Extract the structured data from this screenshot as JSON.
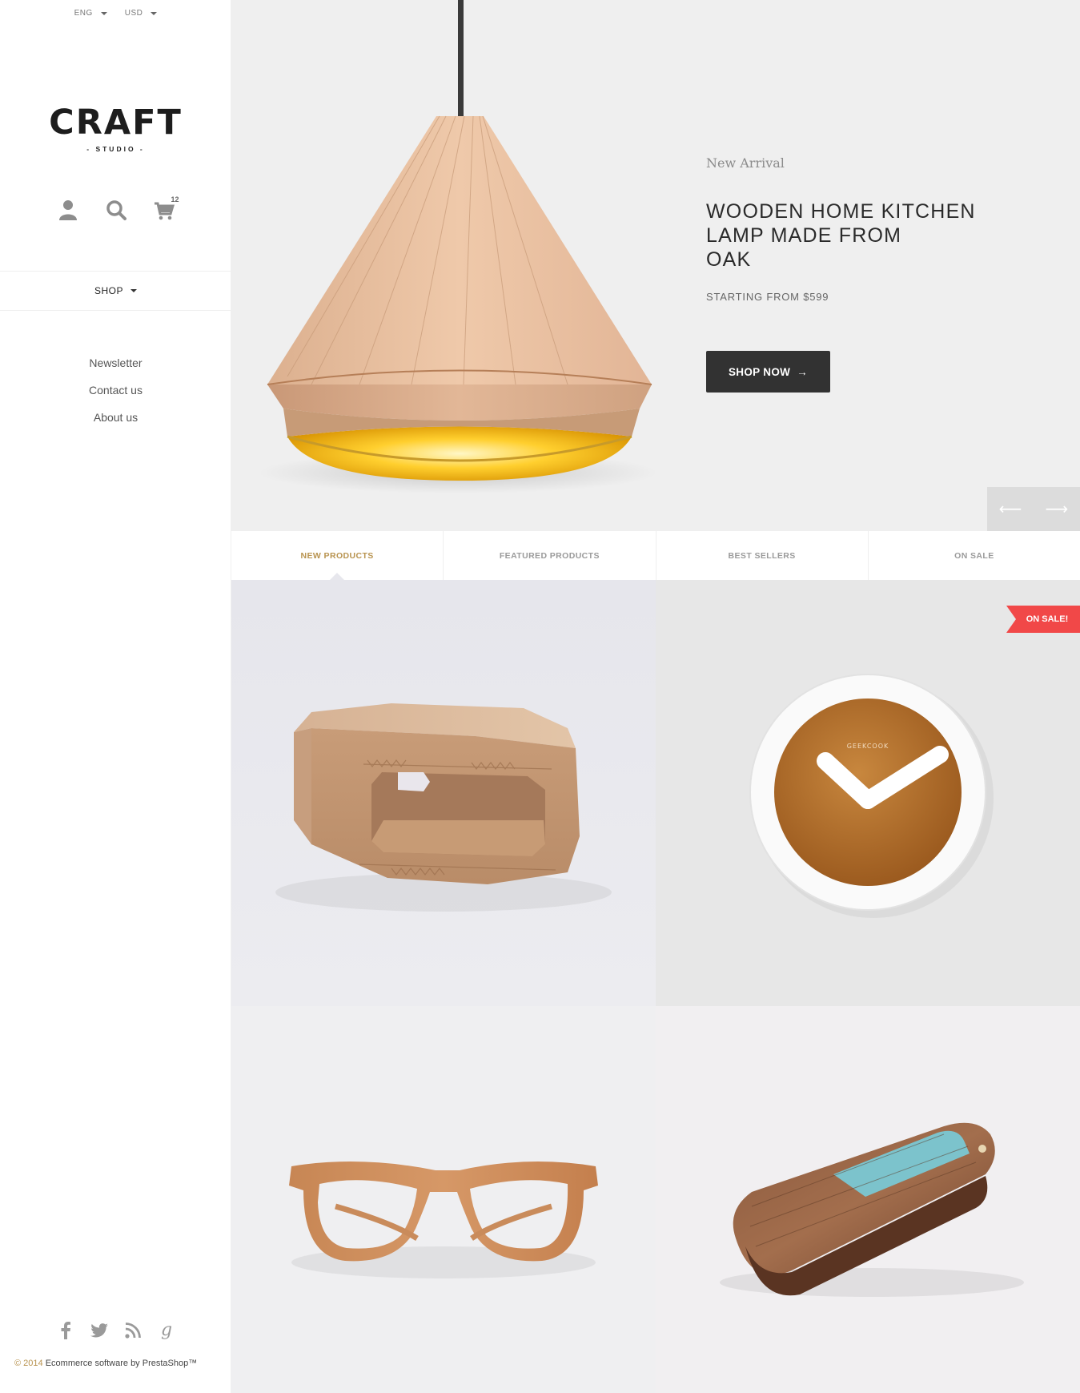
{
  "header": {
    "language": "ENG",
    "currency": "USD"
  },
  "logo": {
    "main": "CRAFT",
    "sub": "- STUDIO -"
  },
  "cart": {
    "count": "12"
  },
  "nav": {
    "shop_label": "SHOP"
  },
  "sidebar_links": [
    "Newsletter",
    "Contact us",
    "About us"
  ],
  "hero": {
    "eyebrow": "New Arrival",
    "title": "WOODEN HOME KITCHEN\nLAMP MADE FROM\nOAK",
    "price": "STARTING FROM $599",
    "button": "SHOP NOW",
    "button_arrow": "→",
    "prev_arrow": "⟵",
    "next_arrow": "⟶"
  },
  "tabs": [
    "NEW PRODUCTS",
    "FEATURED PRODUCTS",
    "BEST SELLERS",
    "ON SALE"
  ],
  "products": {
    "badge": "ON SALE!",
    "clock_brand": "GEEKCOOK"
  },
  "footer": {
    "year": "© 2014",
    "text": "Ecommerce software by PrestaShop™"
  },
  "colors": {
    "accent": "#b8934f",
    "sale": "#f14848",
    "button": "#323232",
    "hero_bg": "#efefef"
  }
}
